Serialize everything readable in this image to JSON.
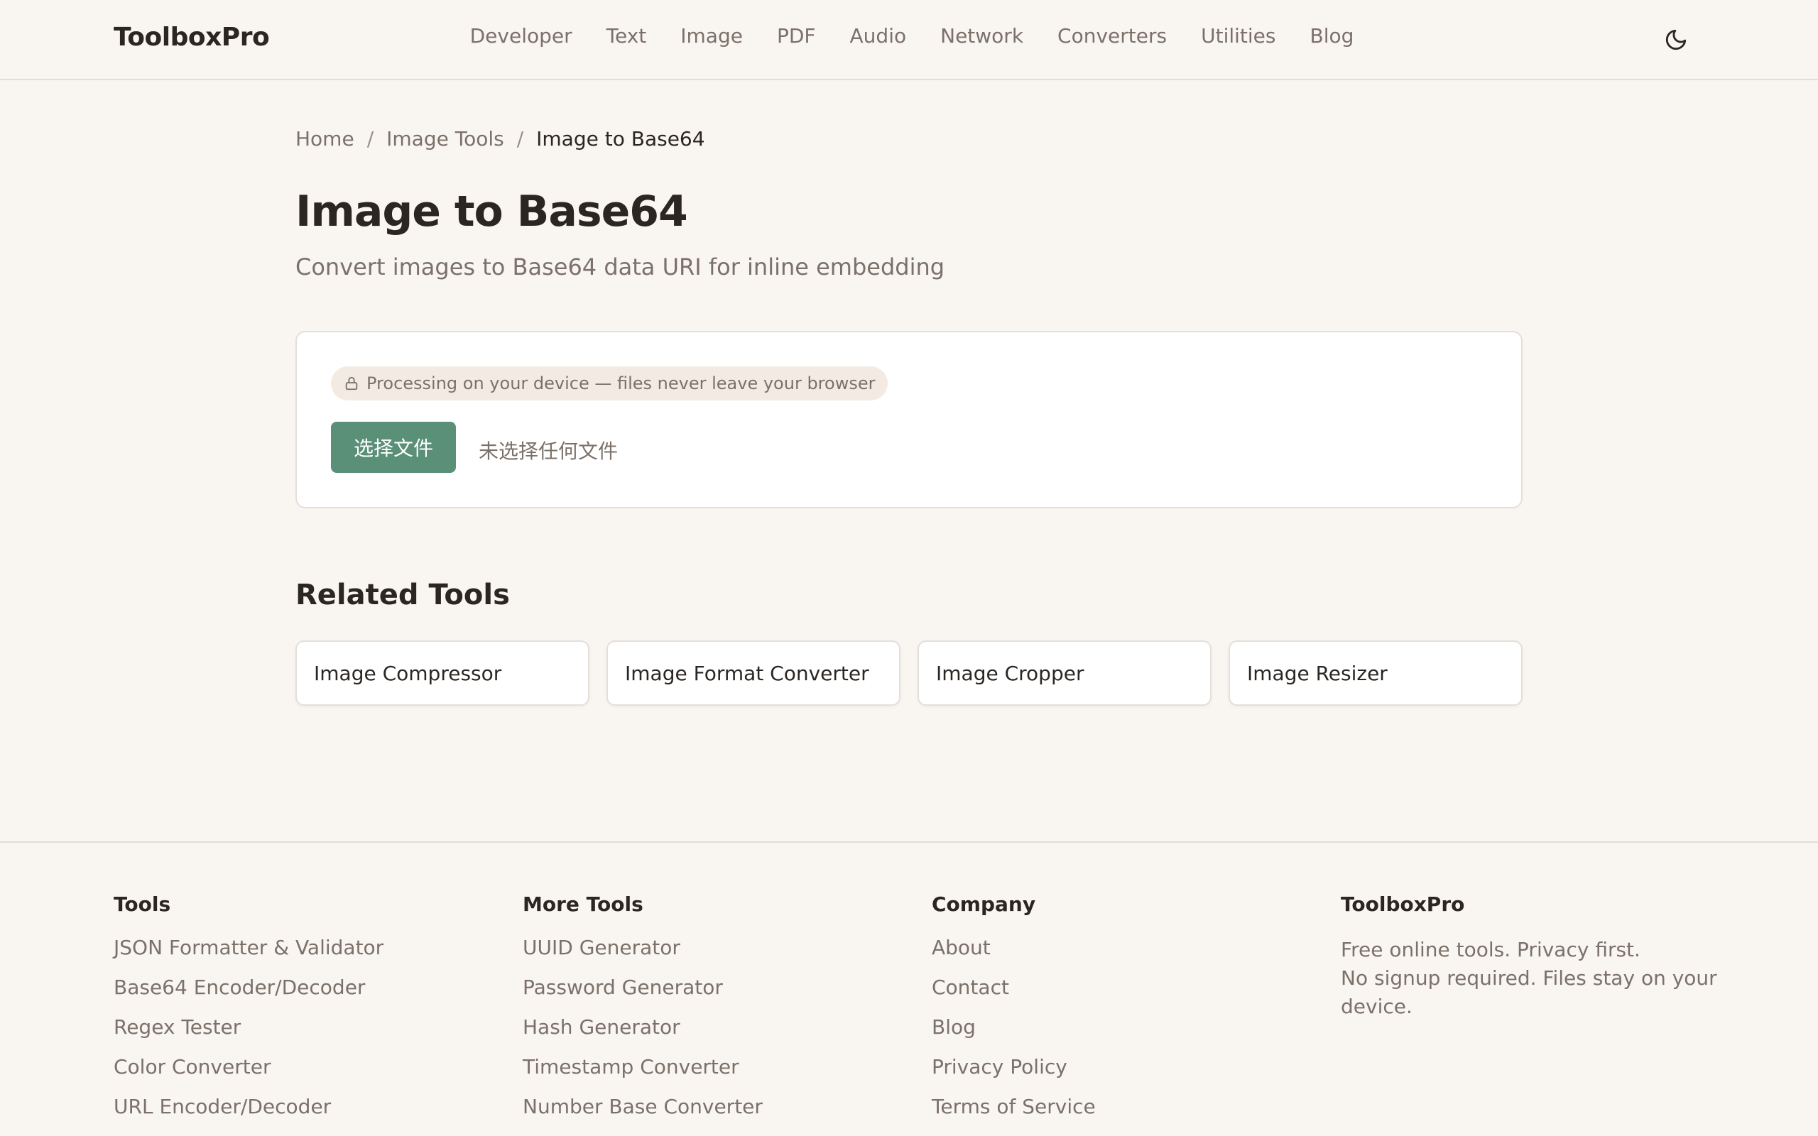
{
  "header": {
    "logo": "ToolboxPro",
    "nav": [
      "Developer",
      "Text",
      "Image",
      "PDF",
      "Audio",
      "Network",
      "Converters",
      "Utilities",
      "Blog"
    ],
    "theme_icon": "moon-icon"
  },
  "breadcrumb": {
    "home": "Home",
    "section": "Image Tools",
    "current": "Image to Base64",
    "separator": "/"
  },
  "page": {
    "title": "Image to Base64",
    "subtitle": "Convert images to Base64 data URI for inline embedding"
  },
  "tool": {
    "privacy_badge": "Processing on your device — files never leave your browser",
    "privacy_icon": "lock-icon",
    "file_button": "选择文件",
    "file_status": "未选择任何文件",
    "accent_color": "#5a8f78"
  },
  "related": {
    "heading": "Related Tools",
    "items": [
      "Image Compressor",
      "Image Format Converter",
      "Image Cropper",
      "Image Resizer"
    ]
  },
  "footer": {
    "tools": {
      "heading": "Tools",
      "links": [
        "JSON Formatter & Validator",
        "Base64 Encoder/Decoder",
        "Regex Tester",
        "Color Converter",
        "URL Encoder/Decoder"
      ]
    },
    "more_tools": {
      "heading": "More Tools",
      "links": [
        "UUID Generator",
        "Password Generator",
        "Hash Generator",
        "Timestamp Converter",
        "Number Base Converter"
      ]
    },
    "company": {
      "heading": "Company",
      "links": [
        "About",
        "Contact",
        "Blog",
        "Privacy Policy",
        "Terms of Service"
      ]
    },
    "brand": {
      "heading": "ToolboxPro",
      "line1": "Free online tools. Privacy first.",
      "line2": "No signup required. Files stay on your device."
    }
  }
}
